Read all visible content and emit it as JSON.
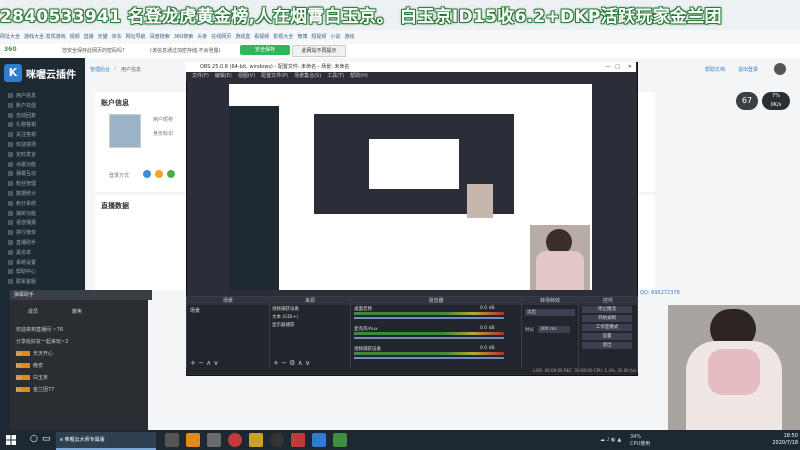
{
  "banner": {
    "text": "2840533941 名登龙虎黄金榜,人在烟霄白玉京。 白玉京ID15收6.2+DKP活跃玩家金兰团"
  },
  "bookmarks": [
    "网址大全",
    "游戏大全·发现游戏",
    "视频",
    "直播",
    "天猫",
    "京东",
    "网址导航",
    "百度搜索",
    "360搜索",
    "头条",
    "在线网页",
    "游戏盒",
    "看视频",
    "影视大全",
    "微博",
    "短视频",
    "小说",
    "游戏"
  ],
  "browser": {
    "prompt": "您安全保存此网页的密码吗?",
    "prompt_sub": "(该信息通过加密存储,不会泄露)",
    "save_btn": "安全保存",
    "no_prompt_btn": "此网站不再提示"
  },
  "app": {
    "logo_mark": "K",
    "logo_text": "咪喔云插件",
    "breadcrumb_home": "管理后台",
    "breadcrumb_sep": "/",
    "breadcrumb_page": "用户信息",
    "help_link": "帮助文档",
    "logout_link": "退出登录",
    "sidebar_items": [
      "用户信息",
      "账户充值",
      "自动回复",
      "礼物答谢",
      "关注答谢",
      "欢迎进场",
      "定时发言",
      "点歌功能",
      "弹幕互动",
      "粉丝管理",
      "数据统计",
      "积分系统",
      "抽奖功能",
      "语音播报",
      "排行榜单",
      "直播助手",
      "黑名单",
      "系统设置",
      "帮助中心",
      "联系客服"
    ],
    "account_info_title": "账户信息",
    "username_label": "用户昵称",
    "identity_label": "身份标识",
    "login_method_label": "登录方式",
    "live_data_title": "直播数据",
    "qq_label": "QQ: 695272378",
    "avatar_level": "67",
    "pct_line1": "7%",
    "pct_line2": "0K/s"
  },
  "chat": {
    "header": "弹幕助手",
    "tab1": "成员",
    "tab2": "聚焦",
    "lines": [
      {
        "badge": "",
        "text": "欢迎来到直播间 ~76"
      },
      {
        "badge": "",
        "text": "分享给好友一起来玩~2"
      },
      {
        "badge": "Lv",
        "text": "天天开心"
      },
      {
        "badge": "Lv",
        "text": "晚安"
      },
      {
        "badge": "Lv",
        "text": "白玉京"
      },
      {
        "badge": "Lv",
        "text": "金兰团77"
      }
    ]
  },
  "obs": {
    "title": "OBS 25.0.8 (64-bit, windows) - 配置文件: 未命名 - 场景: 未命名",
    "menu": [
      "文件(F)",
      "编辑(E)",
      "视图(V)",
      "配置文件(P)",
      "场景集合(S)",
      "工具(T)",
      "帮助(H)"
    ],
    "panels": {
      "scenes": "场景",
      "sources": "来源",
      "mixer": "混音器",
      "transitions": "转场特效",
      "controls": "控件"
    },
    "scene_item": "场景",
    "sources": [
      "视频捕获设备",
      "文本 (GDI+)",
      "显示器捕获"
    ],
    "mixer_tracks": [
      "桌面音频",
      "麦克风/Aux",
      "视频捕获设备"
    ],
    "mixer_db": [
      "0.0 dB",
      "0.0 dB",
      "0.0 dB"
    ],
    "transition": "淡出",
    "duration_label": "时长",
    "duration_value": "300 ms",
    "controls": [
      "停止推流",
      "开始录制",
      "工作室模式",
      "设置",
      "退出"
    ],
    "status": "LIVE: 00:00:00   REC: 00:00:00   CPU: 1.4%, 30.00 fps"
  },
  "taskbar": {
    "app_label": "e 咪喔云大师专属版",
    "time": "18:50",
    "date": "2020/7/18",
    "cpu": "34%",
    "cpu_label": "CPU使用"
  }
}
